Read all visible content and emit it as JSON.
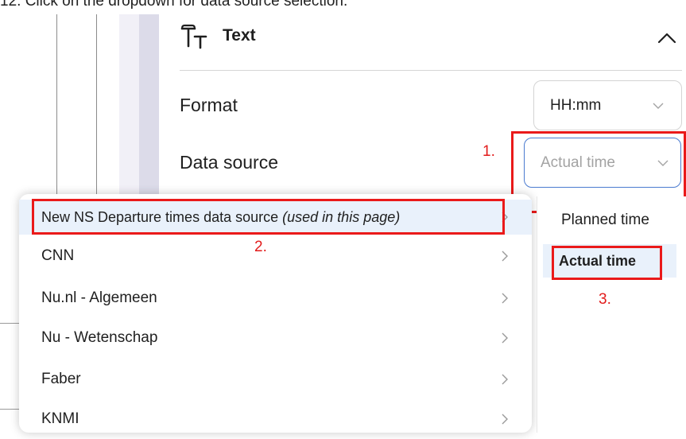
{
  "caption": "12.   Click on the dropdown for data source selection.",
  "text_section": {
    "title": "Text",
    "icon": "text-type-icon",
    "collapse_icon": "chevron-up-icon"
  },
  "format": {
    "label": "Format",
    "value": "HH:mm"
  },
  "data_source": {
    "label": "Data source",
    "value": "Actual time"
  },
  "dropdown": {
    "items": [
      {
        "label": "New NS Departure times data source",
        "note": "(used in this page)"
      },
      {
        "label": "CNN"
      },
      {
        "label": "Nu.nl - Algemeen"
      },
      {
        "label": "Nu - Wetenschap"
      },
      {
        "label": "Faber"
      },
      {
        "label": "KNMI"
      }
    ]
  },
  "subpanel": {
    "items": [
      {
        "label": "Planned time"
      },
      {
        "label": "Actual time"
      }
    ]
  },
  "annotations": [
    "1.",
    "2.",
    "3."
  ],
  "colors": {
    "annotation": "#ea1a1a",
    "active_border": "#4b7bd0",
    "selected_bg": "#e9f1fb"
  }
}
